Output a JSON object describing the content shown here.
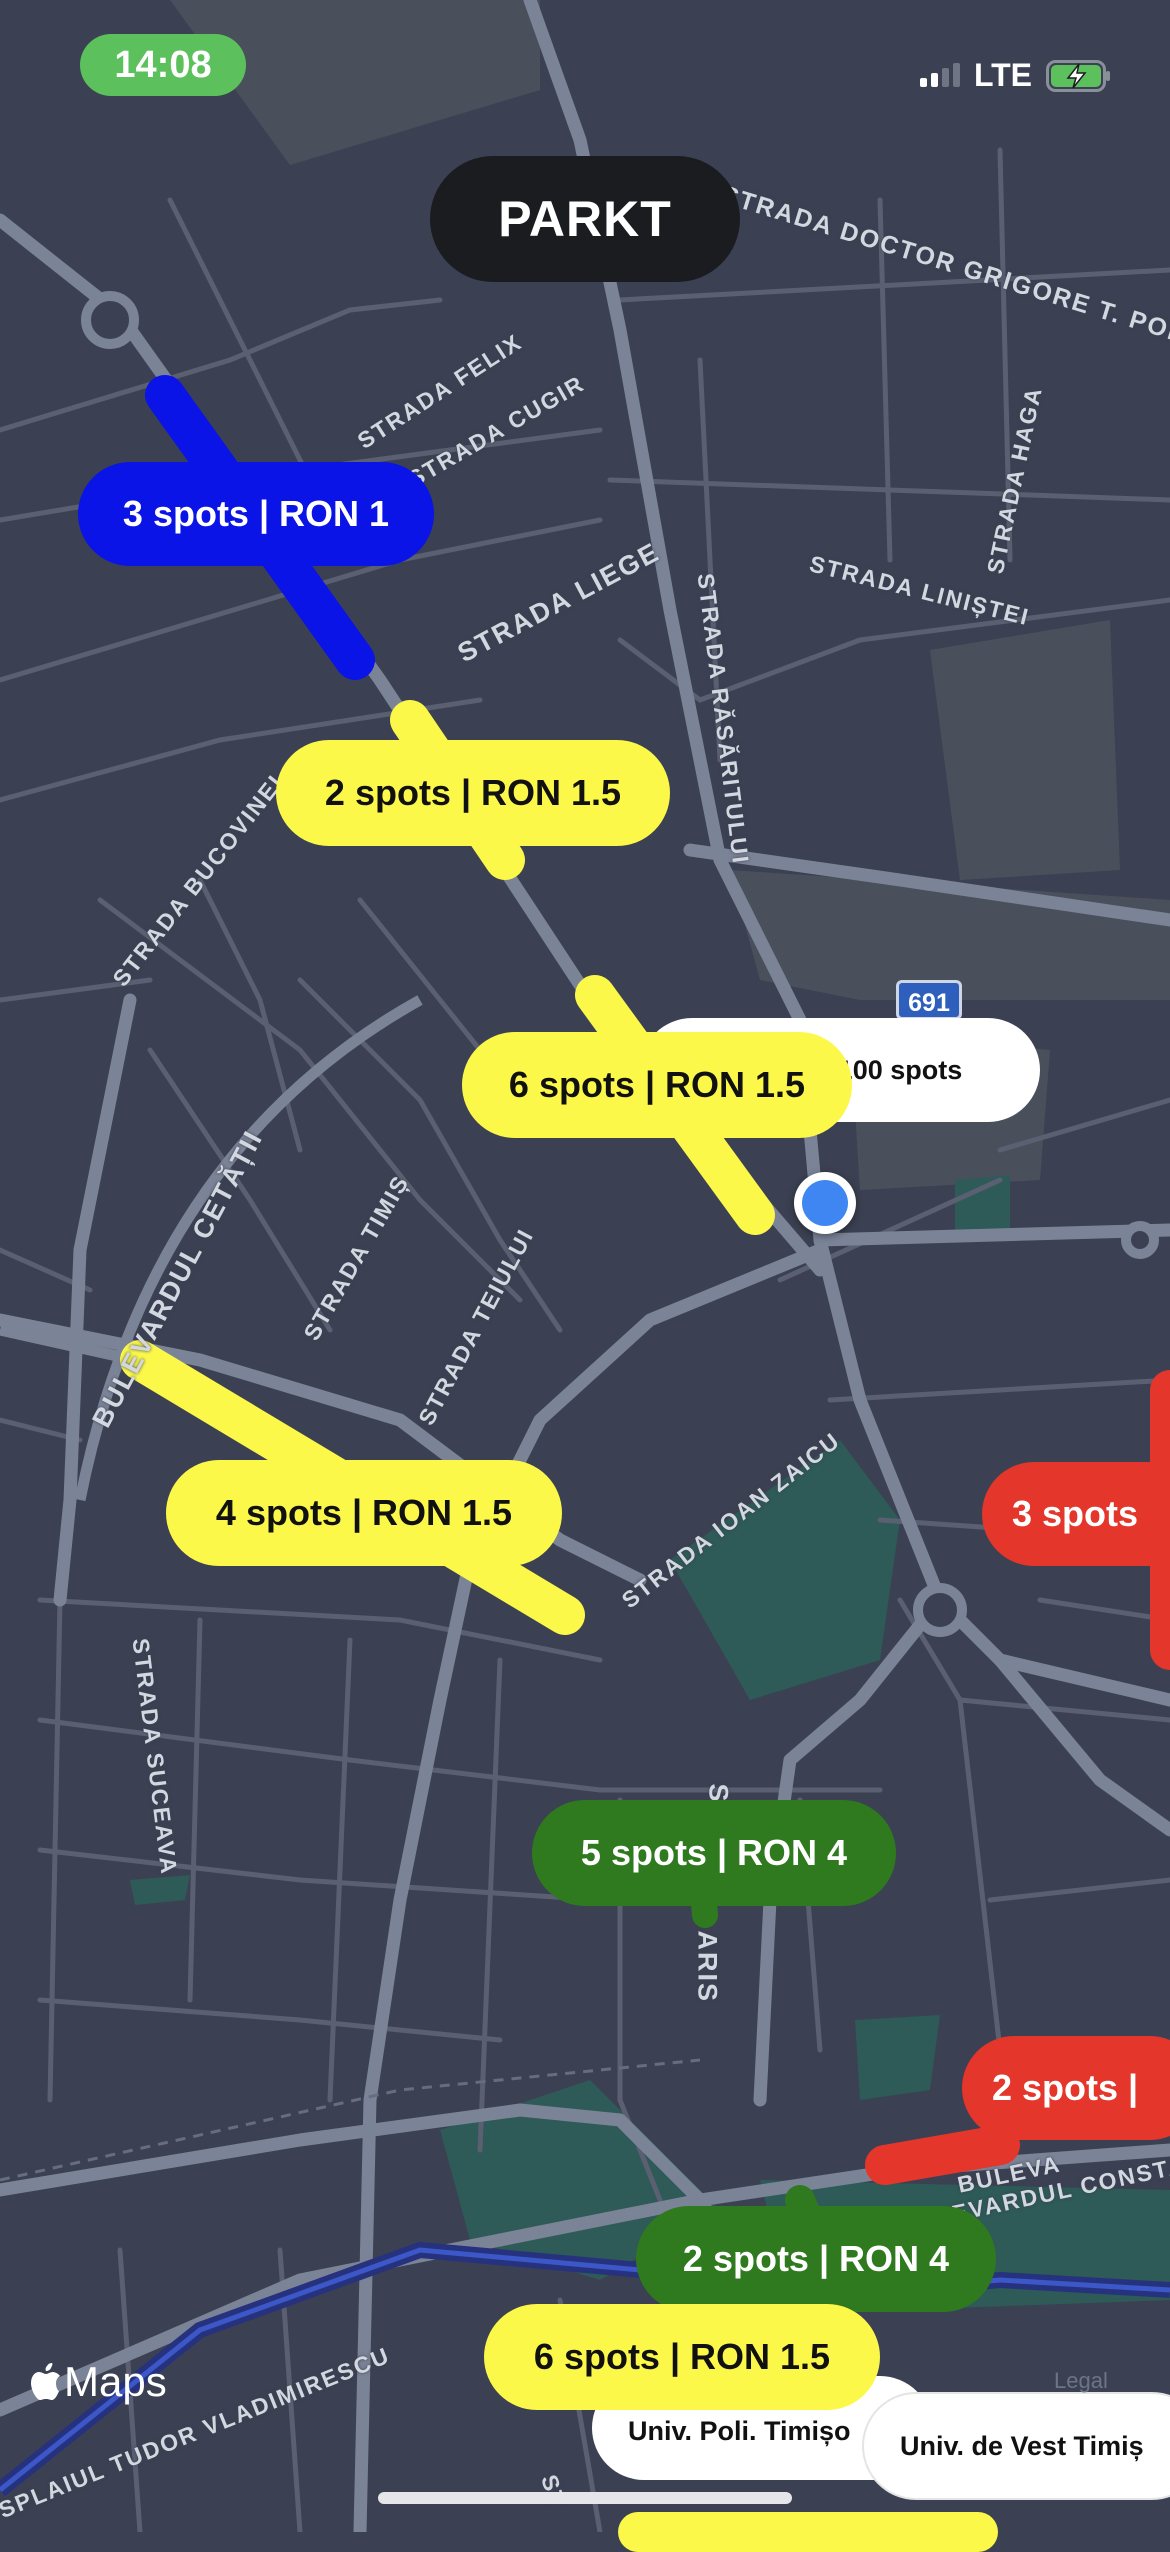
{
  "status_bar": {
    "time": "14:08",
    "network": "LTE"
  },
  "app": {
    "title": "PARKT"
  },
  "colors": {
    "map_bg": "#3b4152",
    "blue": "#0a14e6",
    "yellow": "#fbf84a",
    "green": "#2f7a1e",
    "red": "#e4362a",
    "white": "#ffffff"
  },
  "streets": [
    "STRADA DOCTOR GRIGORE T. POPA",
    "STRADA FELIX",
    "STRADA CUGIR",
    "STRADA LIEGE",
    "STRADA RĂSĂRITULUI",
    "STRADA LINIȘTEI",
    "STRADA HAGA",
    "STRADA BUCOVINEI",
    "BULEVARDUL CETĂȚII",
    "STRADA TIMIȘ",
    "STRADA TEIULUI",
    "STRADA IOAN ZAICU",
    "STRADA SUCEAVA",
    "ST",
    "ARIS",
    "BULEVA",
    "BULEVARDUL CONSTANT",
    "SPLAIUL TUDOR VLADIMIRESCU",
    "ST"
  ],
  "road_badge": "691",
  "parking": [
    {
      "label": "3 spots | RON 1",
      "color": "blue"
    },
    {
      "label": "2 spots | RON 1.5",
      "color": "yellow"
    },
    {
      "label": "100 spots",
      "color": "white"
    },
    {
      "label": "6 spots | RON 1.5",
      "color": "yellow"
    },
    {
      "label": "4 spots | RON 1.5",
      "color": "yellow"
    },
    {
      "label": "3 spots",
      "color": "red"
    },
    {
      "label": "5 spots | RON 4",
      "color": "green"
    },
    {
      "label": "2 spots |",
      "color": "red"
    },
    {
      "label": "2 spots | RON 4",
      "color": "green"
    },
    {
      "label": "6 spots | RON 1.5",
      "color": "yellow"
    },
    {
      "label": "Univ. Poli. Timișo",
      "color": "white"
    },
    {
      "label": "Univ. de Vest Timiș",
      "color": "white"
    }
  ],
  "map_attribution": {
    "logo": "Maps",
    "legal": "Legal"
  }
}
